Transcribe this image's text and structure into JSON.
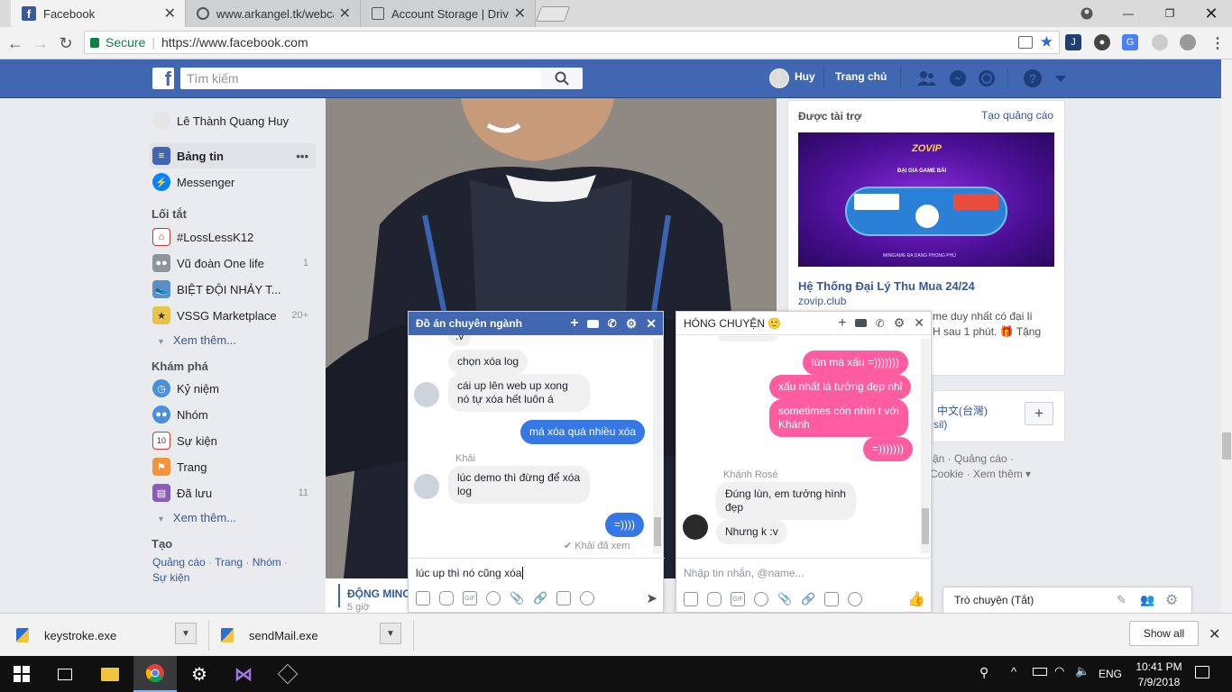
{
  "browser": {
    "tabs": [
      {
        "title": "Facebook",
        "active": true
      },
      {
        "title": "www.arkangel.tk/webcam",
        "active": false
      },
      {
        "title": "Account Storage | DriveH",
        "active": false
      }
    ],
    "secure_label": "Secure",
    "url": "https://www.facebook.com"
  },
  "fb_header": {
    "search_placeholder": "Tìm kiếm",
    "user_name": "Huy",
    "home_label": "Trang chủ"
  },
  "left_nav": {
    "profile_name": "Lê Thành Quang Huy",
    "top_items": [
      {
        "label": "Bảng tin",
        "more": "•••"
      },
      {
        "label": "Messenger"
      }
    ],
    "shortcuts_title": "Lối tắt",
    "shortcuts": [
      {
        "label": "#LossLessK12",
        "count": ""
      },
      {
        "label": "Vũ đoàn One life",
        "count": "1"
      },
      {
        "label": "BIỆT ĐỘI NHẢY T...",
        "count": ""
      },
      {
        "label": "VSSG Marketplace",
        "count": "20+"
      }
    ],
    "see_more_1": "Xem thêm...",
    "explore_title": "Khám phá",
    "explore": [
      {
        "label": "Kỷ niệm",
        "count": ""
      },
      {
        "label": "Nhóm",
        "count": ""
      },
      {
        "label": "Sự kiện",
        "count": ""
      },
      {
        "label": "Trang",
        "count": ""
      },
      {
        "label": "Đã lưu",
        "count": "11"
      }
    ],
    "see_more_2": "Xem thêm...",
    "create_title": "Tạo",
    "create_links": [
      "Quảng cáo",
      "Trang",
      "Nhóm",
      "Sự kiện"
    ]
  },
  "feed": {
    "post_name_partial": "ĐỘNG MINC",
    "post_time_partial": "5 giờ"
  },
  "sponsored": {
    "title": "Được tài trợ",
    "create_ad": "Tạo quảng cáo",
    "banner_brand": "ZOVIP",
    "banner_tagline": "ĐẠI GIA GAME BÀI",
    "banner_footer": "MINIGAME ĐA DẠNG PHONG PHÚ",
    "ad_title": "Hệ Thống Đại Lý Thu Mua 24/24",
    "ad_domain": "zovip.club",
    "ad_text_line1": "me duy nhất có đại lí",
    "ad_text_line2": "H sau 1 phút. 🎁 Tặng",
    "lang_chinese": "中文(台灣)",
    "lang_partial": "sil)",
    "footer_links_1": "ận · Quảng cáo ·",
    "footer_links_2": "Cookie · Xem thêm ▾"
  },
  "chat1": {
    "title": "Đồ án chuyên ngành",
    "messages": [
      {
        "text": ":v",
        "dir": "in"
      },
      {
        "text": "chọn xóa log",
        "dir": "in"
      },
      {
        "text": "cái up lên web up xong nó tự xóa hết luôn á",
        "dir": "in"
      },
      {
        "text": "má xóa quá nhiều xóa",
        "dir": "out"
      },
      {
        "text": "lúc demo thì đừng để xóa log",
        "dir": "in",
        "sender": "Khải"
      },
      {
        "text": "=))))",
        "dir": "out"
      }
    ],
    "seen": "✔ Khải đã xem",
    "input_value": "lúc up thì nó cũng xóa"
  },
  "chat2": {
    "title": "HÓNG CHUYỆN 🙂",
    "messages": [
      {
        "text": "lùn mà xấu =)))))))",
        "dir": "out"
      },
      {
        "text": "xấu nhất là tưởng đẹp nhỉ",
        "dir": "out"
      },
      {
        "text": "sometimes còn nhìn t với Khánh",
        "dir": "out"
      },
      {
        "text": "=)))))))",
        "dir": "out"
      },
      {
        "text": "Đúng lùn, em tưởng hình đẹp",
        "dir": "in",
        "sender": "Khánh Rosé"
      },
      {
        "text": "Nhưng k :v",
        "dir": "in"
      }
    ],
    "input_placeholder": "Nhập tin nhắn, @name..."
  },
  "chat_sidebar": {
    "label": "Trò chuyện (Tắt)"
  },
  "downloads": {
    "items": [
      "keystroke.exe",
      "sendMail.exe"
    ],
    "show_all": "Show all"
  },
  "taskbar": {
    "lang": "ENG",
    "time": "10:41 PM",
    "date": "7/9/2018"
  },
  "colors": {
    "fb_blue": "#4267b2",
    "messenger_blue": "#3578e5",
    "pink_bubble": "#ff5ca1",
    "link": "#365899"
  }
}
